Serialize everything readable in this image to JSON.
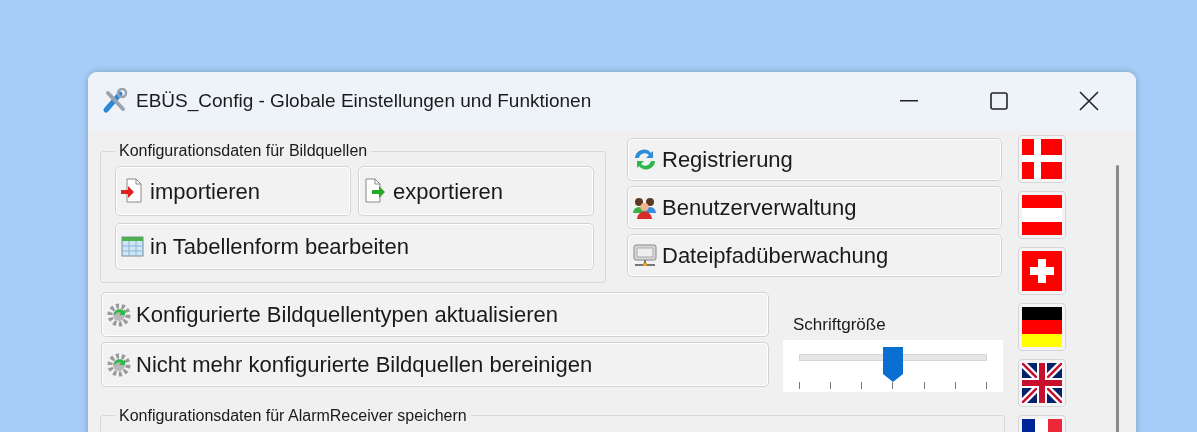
{
  "window": {
    "title": "EBÜS_Config - Globale Einstellungen und Funktionen"
  },
  "group_image_sources": {
    "legend": "Konfigurationsdaten für Bildquellen",
    "buttons": [
      {
        "kind": "import",
        "label": "importieren"
      },
      {
        "kind": "export",
        "label": "exportieren"
      },
      {
        "kind": "table",
        "label": "in Tabellenform bearbeiten"
      }
    ]
  },
  "side_buttons": [
    {
      "kind": "sync",
      "label": "Registrierung"
    },
    {
      "kind": "users",
      "label": "Benutzerverwaltung"
    },
    {
      "kind": "monitor",
      "label": "Dateipfadüberwachung"
    }
  ],
  "action_buttons": [
    {
      "kind": "gear",
      "label": "Konfigurierte Bildquellentypen aktualisieren"
    },
    {
      "kind": "gear",
      "label": "Nicht mehr konfigurierte Bildquellen bereinigen"
    }
  ],
  "font_size": {
    "label": "Schriftgröße",
    "level": 0.5
  },
  "group_alarm": {
    "legend": "Konfigurationsdaten für AlarmReceiver speichern"
  },
  "flags": [
    {
      "kind": "dk"
    },
    {
      "kind": "at"
    },
    {
      "kind": "ch"
    },
    {
      "kind": "de"
    },
    {
      "kind": "gb"
    },
    {
      "kind": "fr"
    }
  ]
}
